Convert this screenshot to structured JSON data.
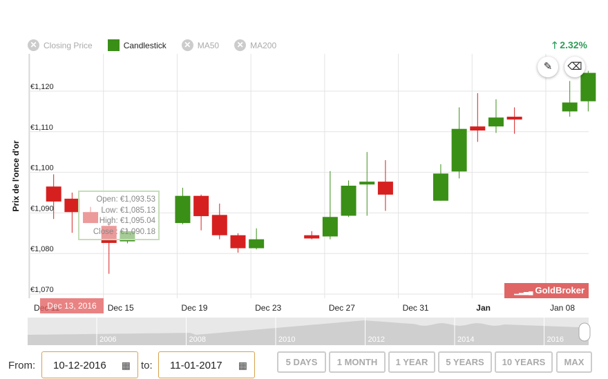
{
  "legend": {
    "closing_price": "Closing Price",
    "candlestick": "Candlestick",
    "ma50": "MA50",
    "ma200": "MA200"
  },
  "change": "2.32%",
  "brand": "GoldBroker",
  "tooltip": {
    "open": "Open: €1,093.53",
    "low": "Low: €1,085.13",
    "high": "High: €1,095.04",
    "close": "Close : €1,090.18"
  },
  "crosshair_date": "Dec 13, 2016",
  "controls": {
    "from_label": "From:",
    "from_value": "10-12-2016",
    "to_label": "to:",
    "to_value": "11-01-2017",
    "ranges": [
      "5 DAYS",
      "1 MONTH",
      "1 YEAR",
      "5 YEARS",
      "10 YEARS",
      "MAX"
    ]
  },
  "colors": {
    "up": "#3a8f17",
    "down": "#d62020",
    "grid": "#e3e3e3"
  },
  "chart_data": {
    "type": "candlestick",
    "ylabel": "Prix de l'once d'or",
    "ylim": [
      1070,
      1125
    ],
    "yticks": [
      "€1,070",
      "€1,080",
      "€1,090",
      "€1,100",
      "€1,110",
      "€1,120"
    ],
    "xticks": [
      {
        "label": "Dec 11",
        "x": 0
      },
      {
        "label": "Dec 15",
        "x": 4
      },
      {
        "label": "Dec 19",
        "x": 8
      },
      {
        "label": "Dec 23",
        "x": 12
      },
      {
        "label": "Dec 27",
        "x": 16
      },
      {
        "label": "Dec 31",
        "x": 20
      },
      {
        "label": "Jan",
        "x": 24,
        "bold": true
      },
      {
        "label": "Jan 08",
        "x": 28
      }
    ],
    "candles": [
      {
        "x": 1.3,
        "o": 1096.5,
        "h": 1099.5,
        "l": 1088.5,
        "c": 1092.8
      },
      {
        "x": 2.3,
        "o": 1093.5,
        "h": 1095.0,
        "l": 1085.1,
        "c": 1090.2
      },
      {
        "x": 3.3,
        "o": 1090.2,
        "h": 1091.5,
        "l": 1087.5,
        "c": 1087.5
      },
      {
        "x": 4.3,
        "o": 1086.8,
        "h": 1087.5,
        "l": 1075.0,
        "c": 1082.6
      },
      {
        "x": 5.3,
        "o": 1083.0,
        "h": 1086.0,
        "l": 1082.5,
        "c": 1085.5
      },
      {
        "x": 8.3,
        "o": 1087.5,
        "h": 1096.2,
        "l": 1087.2,
        "c": 1094.2
      },
      {
        "x": 9.3,
        "o": 1094.2,
        "h": 1094.5,
        "l": 1085.7,
        "c": 1089.2
      },
      {
        "x": 10.3,
        "o": 1089.5,
        "h": 1092.3,
        "l": 1083.5,
        "c": 1084.5
      },
      {
        "x": 11.3,
        "o": 1084.5,
        "h": 1085.0,
        "l": 1080.2,
        "c": 1081.3
      },
      {
        "x": 12.3,
        "o": 1081.3,
        "h": 1086.2,
        "l": 1081.0,
        "c": 1083.5
      },
      {
        "x": 15.3,
        "o": 1084.5,
        "h": 1085.5,
        "l": 1083.5,
        "c": 1083.7
      },
      {
        "x": 16.3,
        "o": 1084.2,
        "h": 1100.3,
        "l": 1083.5,
        "c": 1089.0
      },
      {
        "x": 17.3,
        "o": 1089.3,
        "h": 1098.0,
        "l": 1089.0,
        "c": 1096.7
      },
      {
        "x": 18.3,
        "o": 1097.0,
        "h": 1105.0,
        "l": 1089.3,
        "c": 1097.7
      },
      {
        "x": 19.3,
        "o": 1097.7,
        "h": 1103.0,
        "l": 1090.5,
        "c": 1094.5
      },
      {
        "x": 22.3,
        "o": 1093.0,
        "h": 1102.0,
        "l": 1093.0,
        "c": 1099.7
      },
      {
        "x": 23.3,
        "o": 1100.2,
        "h": 1116.0,
        "l": 1098.5,
        "c": 1110.7
      },
      {
        "x": 24.3,
        "o": 1111.3,
        "h": 1119.5,
        "l": 1107.5,
        "c": 1110.3
      },
      {
        "x": 25.3,
        "o": 1111.3,
        "h": 1118.0,
        "l": 1109.7,
        "c": 1113.5
      },
      {
        "x": 26.3,
        "o": 1113.7,
        "h": 1116.0,
        "l": 1109.5,
        "c": 1113.0
      },
      {
        "x": 29.3,
        "o": 1115.0,
        "h": 1122.5,
        "l": 1113.7,
        "c": 1117.2
      },
      {
        "x": 30.3,
        "o": 1117.5,
        "h": 1125.0,
        "l": 1115.0,
        "c": 1124.5
      }
    ],
    "navigator_years": [
      "2006",
      "2008",
      "2010",
      "2012",
      "2014",
      "2016"
    ]
  }
}
